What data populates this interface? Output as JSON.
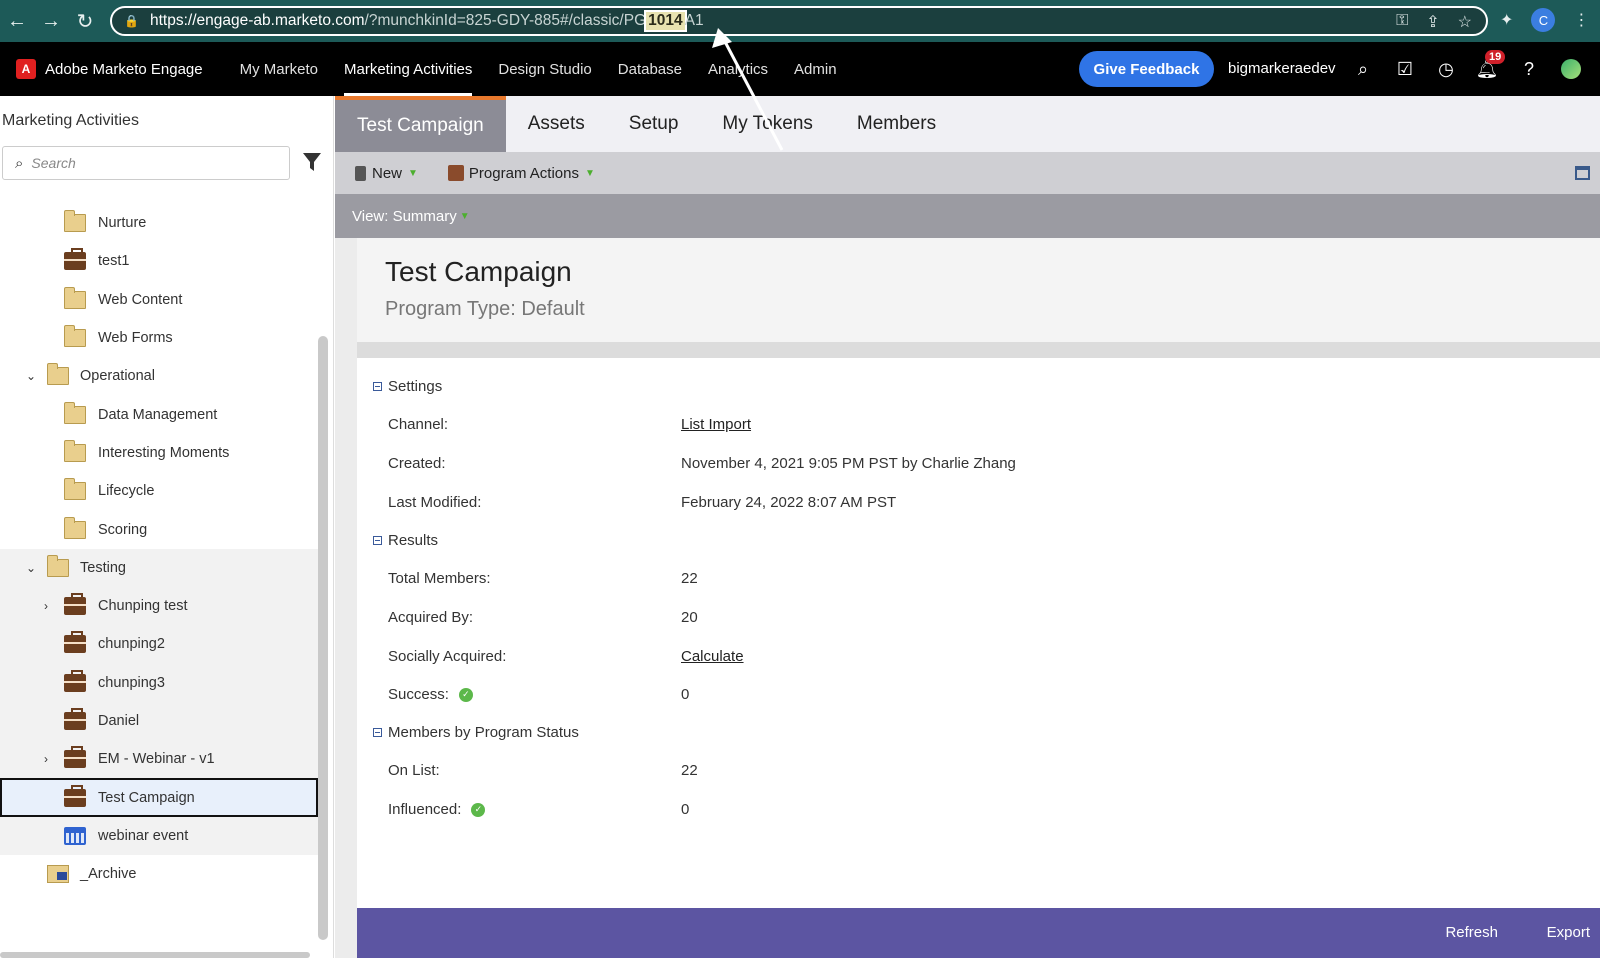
{
  "browser": {
    "url_host": "https://engage-ab.marketo.com",
    "url_path_before": "/?munchkinId=825-GDY-885#/classic/PG",
    "url_highlight": "1014",
    "url_path_after": "A1",
    "profile_initial": "C"
  },
  "header": {
    "brand": "Adobe Marketo Engage",
    "nav": [
      "My Marketo",
      "Marketing Activities",
      "Design Studio",
      "Database",
      "Analytics",
      "Admin"
    ],
    "feedback_label": "Give Feedback",
    "username": "bigmarkeraedev",
    "notification_count": "19"
  },
  "left": {
    "title": "Marketing Activities",
    "search_placeholder": "Search",
    "tree": [
      {
        "label": "Nurture",
        "type": "folder",
        "level": 2
      },
      {
        "label": "test1",
        "type": "program",
        "level": 2
      },
      {
        "label": "Web Content",
        "type": "folder",
        "level": 2
      },
      {
        "label": "Web Forms",
        "type": "folder",
        "level": 2
      },
      {
        "label": "Operational",
        "type": "folder",
        "level": 1,
        "expanded": true
      },
      {
        "label": "Data Management",
        "type": "folder",
        "level": 2
      },
      {
        "label": "Interesting Moments",
        "type": "folder",
        "level": 2
      },
      {
        "label": "Lifecycle",
        "type": "folder",
        "level": 2
      },
      {
        "label": "Scoring",
        "type": "folder",
        "level": 2
      },
      {
        "label": "Testing",
        "type": "folder",
        "level": 1,
        "expanded": true
      },
      {
        "label": "Chunping test",
        "type": "program",
        "level": 2,
        "collapsed": true
      },
      {
        "label": "chunping2",
        "type": "program",
        "level": 2
      },
      {
        "label": "chunping3",
        "type": "program",
        "level": 2
      },
      {
        "label": "Daniel",
        "type": "program",
        "level": 2
      },
      {
        "label": "EM - Webinar - v1",
        "type": "program",
        "level": 2,
        "collapsed": true
      },
      {
        "label": "Test Campaign",
        "type": "program",
        "level": 2,
        "selected": true
      },
      {
        "label": "webinar event",
        "type": "event",
        "level": 2
      },
      {
        "label": "_Archive",
        "type": "archive",
        "level": 1
      }
    ]
  },
  "main": {
    "tabs": [
      "Test Campaign",
      "Assets",
      "Setup",
      "My Tokens",
      "Members"
    ],
    "toolbar": {
      "new_label": "New",
      "program_actions_label": "Program Actions"
    },
    "view_label": "View: Summary",
    "title": "Test Campaign",
    "program_type": "Program Type: Default",
    "sections": {
      "settings": "Settings",
      "results": "Results",
      "members_by_status": "Members by Program Status"
    },
    "fields": {
      "channel_label": "Channel:",
      "channel_value": "List Import",
      "created_label": "Created:",
      "created_value": "November 4, 2021 9:05 PM PST by Charlie Zhang",
      "modified_label": "Last Modified:",
      "modified_value": "February 24, 2022 8:07 AM PST",
      "total_members_label": "Total Members:",
      "total_members_value": "22",
      "acquired_label": "Acquired By:",
      "acquired_value": "20",
      "social_label": "Socially Acquired:",
      "social_value": "Calculate",
      "success_label": "Success:",
      "success_value": "0",
      "onlist_label": "On List:",
      "onlist_value": "22",
      "influenced_label": "Influenced:",
      "influenced_value": "0"
    },
    "footer": {
      "refresh": "Refresh",
      "export": "Export"
    }
  }
}
